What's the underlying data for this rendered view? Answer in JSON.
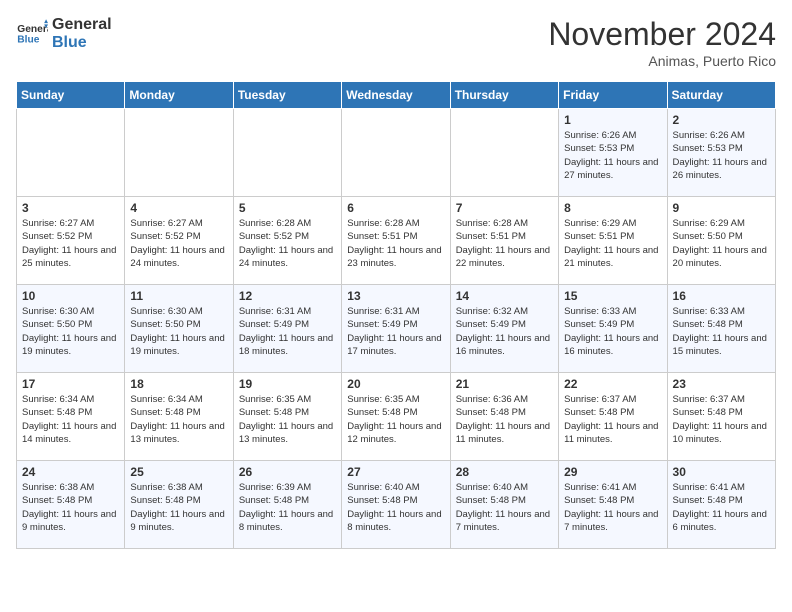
{
  "logo": {
    "line1": "General",
    "line2": "Blue"
  },
  "title": "November 2024",
  "subtitle": "Animas, Puerto Rico",
  "days_of_week": [
    "Sunday",
    "Monday",
    "Tuesday",
    "Wednesday",
    "Thursday",
    "Friday",
    "Saturday"
  ],
  "weeks": [
    [
      {
        "day": "",
        "info": ""
      },
      {
        "day": "",
        "info": ""
      },
      {
        "day": "",
        "info": ""
      },
      {
        "day": "",
        "info": ""
      },
      {
        "day": "",
        "info": ""
      },
      {
        "day": "1",
        "info": "Sunrise: 6:26 AM\nSunset: 5:53 PM\nDaylight: 11 hours and 27 minutes."
      },
      {
        "day": "2",
        "info": "Sunrise: 6:26 AM\nSunset: 5:53 PM\nDaylight: 11 hours and 26 minutes."
      }
    ],
    [
      {
        "day": "3",
        "info": "Sunrise: 6:27 AM\nSunset: 5:52 PM\nDaylight: 11 hours and 25 minutes."
      },
      {
        "day": "4",
        "info": "Sunrise: 6:27 AM\nSunset: 5:52 PM\nDaylight: 11 hours and 24 minutes."
      },
      {
        "day": "5",
        "info": "Sunrise: 6:28 AM\nSunset: 5:52 PM\nDaylight: 11 hours and 24 minutes."
      },
      {
        "day": "6",
        "info": "Sunrise: 6:28 AM\nSunset: 5:51 PM\nDaylight: 11 hours and 23 minutes."
      },
      {
        "day": "7",
        "info": "Sunrise: 6:28 AM\nSunset: 5:51 PM\nDaylight: 11 hours and 22 minutes."
      },
      {
        "day": "8",
        "info": "Sunrise: 6:29 AM\nSunset: 5:51 PM\nDaylight: 11 hours and 21 minutes."
      },
      {
        "day": "9",
        "info": "Sunrise: 6:29 AM\nSunset: 5:50 PM\nDaylight: 11 hours and 20 minutes."
      }
    ],
    [
      {
        "day": "10",
        "info": "Sunrise: 6:30 AM\nSunset: 5:50 PM\nDaylight: 11 hours and 19 minutes."
      },
      {
        "day": "11",
        "info": "Sunrise: 6:30 AM\nSunset: 5:50 PM\nDaylight: 11 hours and 19 minutes."
      },
      {
        "day": "12",
        "info": "Sunrise: 6:31 AM\nSunset: 5:49 PM\nDaylight: 11 hours and 18 minutes."
      },
      {
        "day": "13",
        "info": "Sunrise: 6:31 AM\nSunset: 5:49 PM\nDaylight: 11 hours and 17 minutes."
      },
      {
        "day": "14",
        "info": "Sunrise: 6:32 AM\nSunset: 5:49 PM\nDaylight: 11 hours and 16 minutes."
      },
      {
        "day": "15",
        "info": "Sunrise: 6:33 AM\nSunset: 5:49 PM\nDaylight: 11 hours and 16 minutes."
      },
      {
        "day": "16",
        "info": "Sunrise: 6:33 AM\nSunset: 5:48 PM\nDaylight: 11 hours and 15 minutes."
      }
    ],
    [
      {
        "day": "17",
        "info": "Sunrise: 6:34 AM\nSunset: 5:48 PM\nDaylight: 11 hours and 14 minutes."
      },
      {
        "day": "18",
        "info": "Sunrise: 6:34 AM\nSunset: 5:48 PM\nDaylight: 11 hours and 13 minutes."
      },
      {
        "day": "19",
        "info": "Sunrise: 6:35 AM\nSunset: 5:48 PM\nDaylight: 11 hours and 13 minutes."
      },
      {
        "day": "20",
        "info": "Sunrise: 6:35 AM\nSunset: 5:48 PM\nDaylight: 11 hours and 12 minutes."
      },
      {
        "day": "21",
        "info": "Sunrise: 6:36 AM\nSunset: 5:48 PM\nDaylight: 11 hours and 11 minutes."
      },
      {
        "day": "22",
        "info": "Sunrise: 6:37 AM\nSunset: 5:48 PM\nDaylight: 11 hours and 11 minutes."
      },
      {
        "day": "23",
        "info": "Sunrise: 6:37 AM\nSunset: 5:48 PM\nDaylight: 11 hours and 10 minutes."
      }
    ],
    [
      {
        "day": "24",
        "info": "Sunrise: 6:38 AM\nSunset: 5:48 PM\nDaylight: 11 hours and 9 minutes."
      },
      {
        "day": "25",
        "info": "Sunrise: 6:38 AM\nSunset: 5:48 PM\nDaylight: 11 hours and 9 minutes."
      },
      {
        "day": "26",
        "info": "Sunrise: 6:39 AM\nSunset: 5:48 PM\nDaylight: 11 hours and 8 minutes."
      },
      {
        "day": "27",
        "info": "Sunrise: 6:40 AM\nSunset: 5:48 PM\nDaylight: 11 hours and 8 minutes."
      },
      {
        "day": "28",
        "info": "Sunrise: 6:40 AM\nSunset: 5:48 PM\nDaylight: 11 hours and 7 minutes."
      },
      {
        "day": "29",
        "info": "Sunrise: 6:41 AM\nSunset: 5:48 PM\nDaylight: 11 hours and 7 minutes."
      },
      {
        "day": "30",
        "info": "Sunrise: 6:41 AM\nSunset: 5:48 PM\nDaylight: 11 hours and 6 minutes."
      }
    ]
  ]
}
